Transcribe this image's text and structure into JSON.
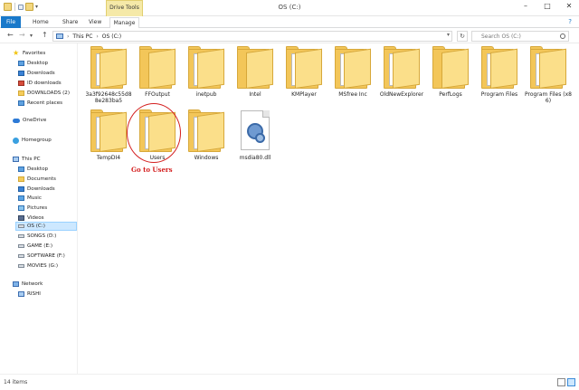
{
  "window": {
    "title": "OS (C:)"
  },
  "ribbon": {
    "tabs": {
      "file": "File",
      "home": "Home",
      "share": "Share",
      "view": "View",
      "manage": "Manage"
    },
    "context_group": "Drive Tools"
  },
  "address": {
    "root": "This PC",
    "current": "OS (C:)",
    "search_placeholder": "Search OS (C:)"
  },
  "nav": {
    "favorites": "Favorites",
    "desktop": "Desktop",
    "downloads": "Downloads",
    "id_downloads": "ID downloads",
    "downloads2": "DOWNLOADS (2)",
    "recent": "Recent places",
    "onedrive": "OneDrive",
    "homegroup": "Homegroup",
    "thispc": "This PC",
    "pc_desktop": "Desktop",
    "pc_documents": "Documents",
    "pc_downloads": "Downloads",
    "pc_music": "Music",
    "pc_pictures": "Pictures",
    "pc_videos": "Videos",
    "drive_c": "OS (C:)",
    "drive_d": "SONGS (D:)",
    "drive_e": "GAME (E:)",
    "drive_f": "SOFTWARE (F:)",
    "drive_g": "MOVIES (G:)",
    "network": "Network",
    "rishi": "RISHI"
  },
  "items": [
    {
      "name": "3a3f92648c55d88e283ba5",
      "kind": "folder"
    },
    {
      "name": "FFOutput",
      "kind": "folder"
    },
    {
      "name": "inetpub",
      "kind": "folder"
    },
    {
      "name": "Intel",
      "kind": "folder"
    },
    {
      "name": "KMPlayer",
      "kind": "folder"
    },
    {
      "name": "MSfree Inc",
      "kind": "folder"
    },
    {
      "name": "OldNewExplorer",
      "kind": "folder"
    },
    {
      "name": "PerfLogs",
      "kind": "folder"
    },
    {
      "name": "Program Files",
      "kind": "folder"
    },
    {
      "name": "Program Files (x86)",
      "kind": "folder"
    },
    {
      "name": "TempDI4",
      "kind": "folder"
    },
    {
      "name": "Users",
      "kind": "folder"
    },
    {
      "name": "Windows",
      "kind": "folder"
    },
    {
      "name": "msdia80.dll",
      "kind": "file"
    }
  ],
  "annotation": "Go to Users",
  "status": {
    "count": "14 items"
  },
  "colors": {
    "accent": "#1979ca",
    "annotation": "#d42020",
    "folder": "#f3c659"
  }
}
